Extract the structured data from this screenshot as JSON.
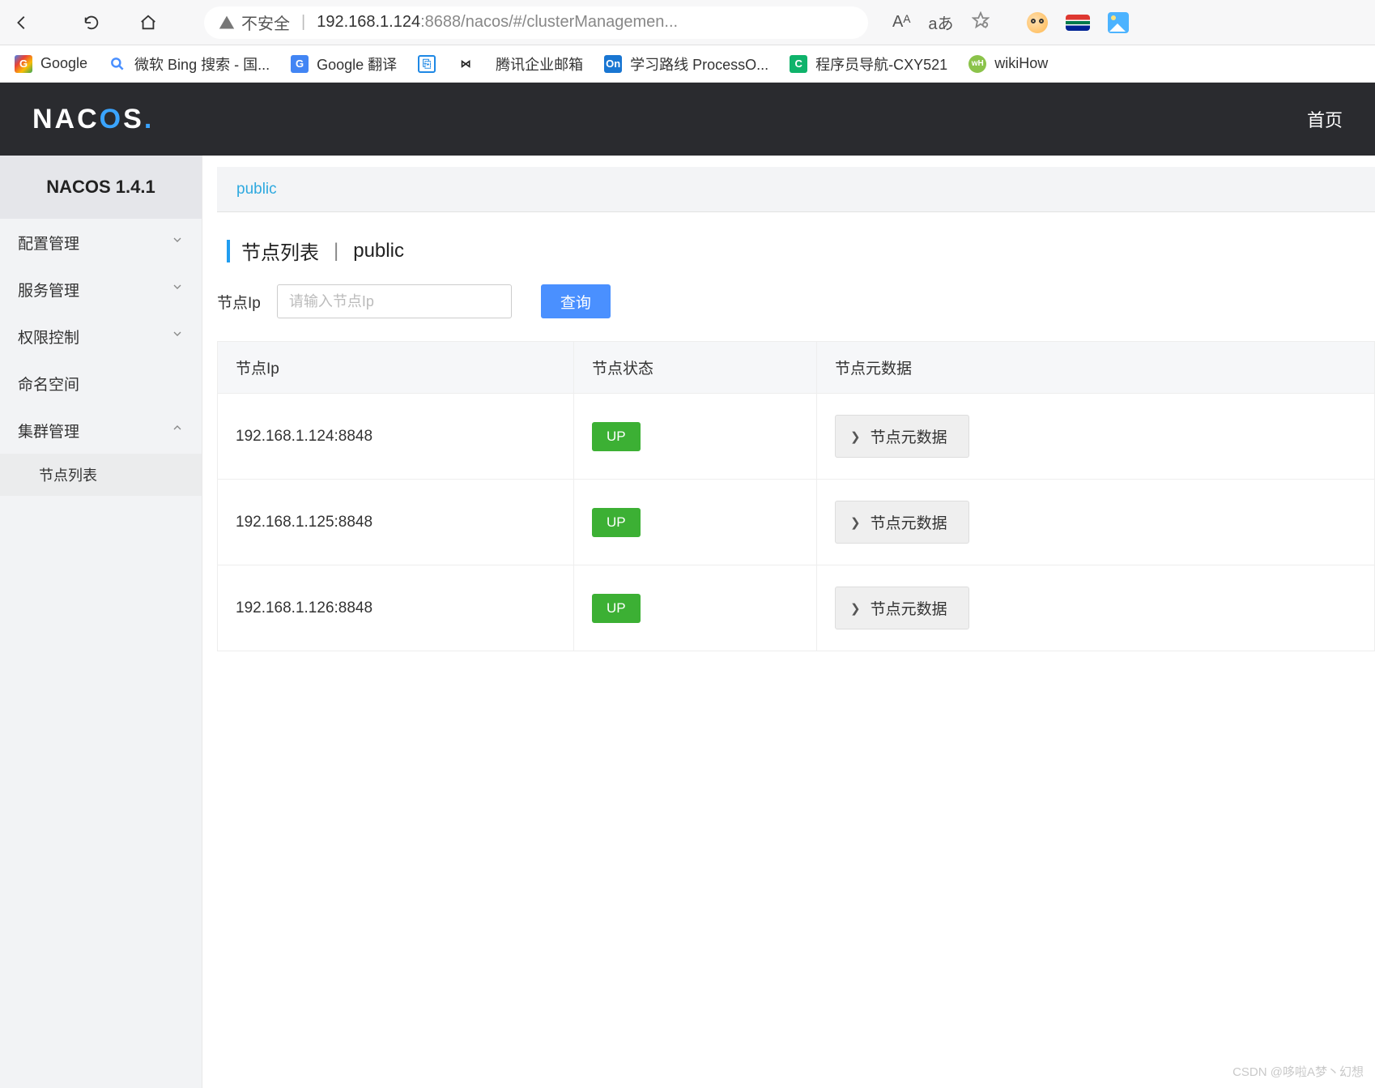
{
  "browser": {
    "insecure_label": "不安全",
    "url_host": "192.168.1.124",
    "url_port": ":8688",
    "url_path": "/nacos/#/clusterManagemen...",
    "aa_label": "aあ",
    "a_label": "Aᴬ"
  },
  "bookmarks": [
    {
      "label": "Google"
    },
    {
      "label": "微软 Bing 搜索 - 国..."
    },
    {
      "label": "Google 翻译"
    },
    {
      "label": ""
    },
    {
      "label": ""
    },
    {
      "label": "腾讯企业邮箱"
    },
    {
      "label": "学习路线 ProcessO..."
    },
    {
      "label": "程序员导航-CXY521"
    },
    {
      "label": "wikiHow"
    }
  ],
  "header": {
    "logo_text_pre": "NAC",
    "logo_text_o": "O",
    "logo_text_s": "S",
    "logo_dot": ".",
    "nav_home": "首页"
  },
  "sidebar": {
    "title": "NACOS 1.4.1",
    "items": [
      {
        "label": "配置管理",
        "expanded": false
      },
      {
        "label": "服务管理",
        "expanded": false
      },
      {
        "label": "权限控制",
        "expanded": false
      },
      {
        "label": "命名空间",
        "chev": false
      },
      {
        "label": "集群管理",
        "expanded": true
      }
    ],
    "sub_node_list": "节点列表"
  },
  "tabs": {
    "public": "public"
  },
  "page": {
    "title": "节点列表",
    "sep": "|",
    "namespace": "public"
  },
  "filters": {
    "label": "节点Ip",
    "placeholder": "请输入节点Ip",
    "query_btn": "查询"
  },
  "table": {
    "columns": {
      "ip": "节点Ip",
      "status": "节点状态",
      "meta": "节点元数据"
    },
    "rows": [
      {
        "ip": "192.168.1.124:8848",
        "status": "UP",
        "meta_btn": "节点元数据"
      },
      {
        "ip": "192.168.1.125:8848",
        "status": "UP",
        "meta_btn": "节点元数据"
      },
      {
        "ip": "192.168.1.126:8848",
        "status": "UP",
        "meta_btn": "节点元数据"
      }
    ]
  },
  "watermark": "CSDN @哆啦A梦丶幻想"
}
